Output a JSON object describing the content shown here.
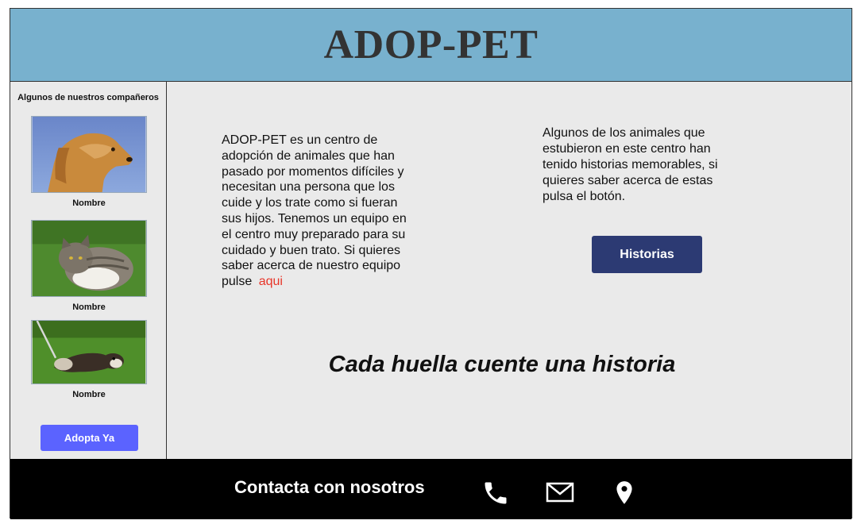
{
  "header": {
    "title": "ADOP-PET"
  },
  "sidebar": {
    "title": "Algunos de nuestros compañeros",
    "pets": [
      {
        "name": "Nombre",
        "photo": "golden-retriever-photo"
      },
      {
        "name": "Nombre",
        "photo": "tabby-cat-photo"
      },
      {
        "name": "Nombre",
        "photo": "ferret-photo"
      }
    ],
    "adopt_label": "Adopta Ya"
  },
  "main": {
    "about_text": "ADOP-PET es un centro de adopción de animales que han pasado por momentos difíciles y necesitan una persona que los cuide y los trate como si fueran sus hijos. Tenemos un equipo en el centro muy preparado para su cuidado y buen trato. Si quieres saber acerca de nuestro equipo pulse",
    "about_link": "aqui",
    "stories_text": "Algunos de los animales que estubieron en este centro han tenido historias memorables, si quieres saber acerca de estas pulsa el botón.",
    "stories_button": "Historias",
    "tagline": "Cada huella cuente una historia"
  },
  "footer": {
    "title": "Contacta con nosotros",
    "icons": [
      "phone-icon",
      "mail-icon",
      "location-icon"
    ]
  },
  "colors": {
    "header_bg": "#78b1ce",
    "page_bg": "#eaeaea",
    "adopt_button": "#5b63ff",
    "stories_button": "#2c3a73",
    "link": "#e8362a",
    "footer_bg": "#000000"
  }
}
